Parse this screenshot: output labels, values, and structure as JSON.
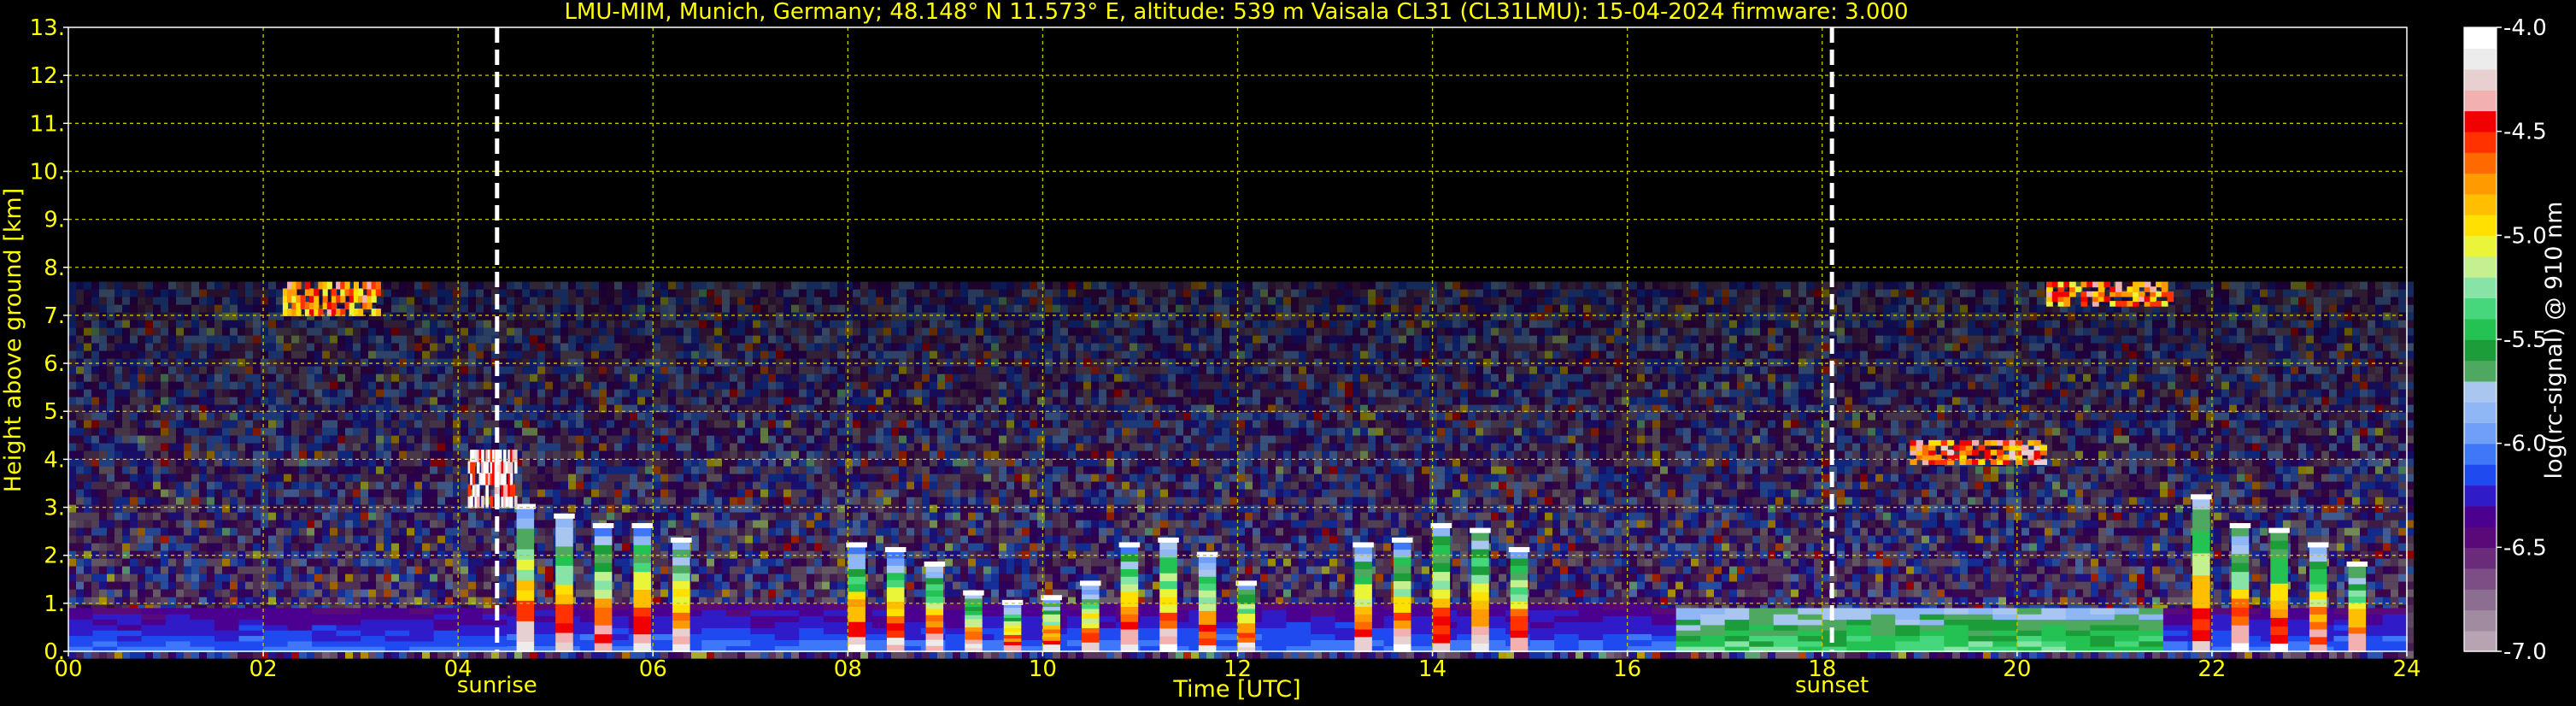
{
  "chart_data": {
    "type": "heatmap",
    "title": "LMU-MIM, Munich, Germany; 48.148° N 11.573° E, altitude: 539 m    Vaisala CL31 (CL31LMU): 15-04-2024    firmware: 3.000",
    "xlabel": "Time [UTC]",
    "ylabel": "Height above ground [km]",
    "xlim": [
      0,
      24
    ],
    "ylim": [
      0,
      13
    ],
    "x_ticks": [
      "00",
      "02",
      "04",
      "06",
      "08",
      "10",
      "12",
      "14",
      "16",
      "18",
      "20",
      "22",
      "24"
    ],
    "y_ticks": [
      "0.",
      "1.",
      "2.",
      "3.",
      "4.",
      "5.",
      "6.",
      "7.",
      "8.",
      "9.",
      "10.",
      "11.",
      "12.",
      "13."
    ],
    "grid": true,
    "colorbar": {
      "label": "log(rc-signal) @ 910 nm",
      "range": [
        -7.0,
        -4.0
      ],
      "ticks": [
        "-4.0",
        "-4.5",
        "-5.0",
        "-5.5",
        "-6.0",
        "-6.5",
        "-7.0"
      ],
      "colors": [
        "#b7a3b2",
        "#a08ba0",
        "#8c6e91",
        "#7c4e85",
        "#6a2c7a",
        "#5a0a78",
        "#4b0090",
        "#2f1cc8",
        "#1f4af0",
        "#3e78f8",
        "#6f9ff8",
        "#8fb6f5",
        "#a8c6f0",
        "#4fa860",
        "#1d9c3a",
        "#23c253",
        "#46d67c",
        "#88e4a6",
        "#c5f090",
        "#eaf53a",
        "#ffe000",
        "#ffbf00",
        "#ff9a00",
        "#ff6a00",
        "#ff3200",
        "#f00000",
        "#f2b0b0",
        "#e8d0d0",
        "#ececec",
        "#ffffff"
      ]
    },
    "annotations": [
      {
        "text": "sunrise",
        "x": 4.4
      },
      {
        "text": "sunset",
        "x": 18.1
      }
    ],
    "noise_top_km": 7.7,
    "cloud_layers": [
      {
        "x": [
          2.2,
          3.2
        ],
        "y": [
          7.0,
          7.7
        ],
        "level": -4.7
      },
      {
        "x": [
          20.3,
          21.6
        ],
        "y": [
          7.2,
          7.7
        ],
        "level": -4.7
      },
      {
        "x": [
          18.9,
          20.3
        ],
        "y": [
          3.9,
          4.4
        ],
        "level": -4.6
      },
      {
        "x": [
          4.1,
          4.6
        ],
        "y": [
          3.0,
          4.2
        ],
        "level": -4.2
      }
    ],
    "precip_columns": [
      {
        "x": 4.6,
        "top": 3.0
      },
      {
        "x": 5.0,
        "top": 2.8
      },
      {
        "x": 5.4,
        "top": 2.6
      },
      {
        "x": 5.8,
        "top": 2.6
      },
      {
        "x": 6.2,
        "top": 2.3
      },
      {
        "x": 8.0,
        "top": 2.2
      },
      {
        "x": 8.4,
        "top": 2.1
      },
      {
        "x": 8.8,
        "top": 1.8
      },
      {
        "x": 9.2,
        "top": 1.2
      },
      {
        "x": 9.6,
        "top": 1.0
      },
      {
        "x": 10.0,
        "top": 1.1
      },
      {
        "x": 10.4,
        "top": 1.4
      },
      {
        "x": 10.8,
        "top": 2.2
      },
      {
        "x": 11.2,
        "top": 2.3
      },
      {
        "x": 11.6,
        "top": 2.0
      },
      {
        "x": 12.0,
        "top": 1.4
      },
      {
        "x": 13.2,
        "top": 2.2
      },
      {
        "x": 13.6,
        "top": 2.3
      },
      {
        "x": 14.0,
        "top": 2.6
      },
      {
        "x": 14.4,
        "top": 2.5
      },
      {
        "x": 14.8,
        "top": 2.1
      },
      {
        "x": 21.8,
        "top": 3.2
      },
      {
        "x": 22.2,
        "top": 2.6
      },
      {
        "x": 22.6,
        "top": 2.5
      },
      {
        "x": 23.0,
        "top": 2.2
      },
      {
        "x": 23.4,
        "top": 1.8
      }
    ],
    "boundary_layer": {
      "day_top_km": 1.0,
      "night_top_km": 0.9
    }
  }
}
